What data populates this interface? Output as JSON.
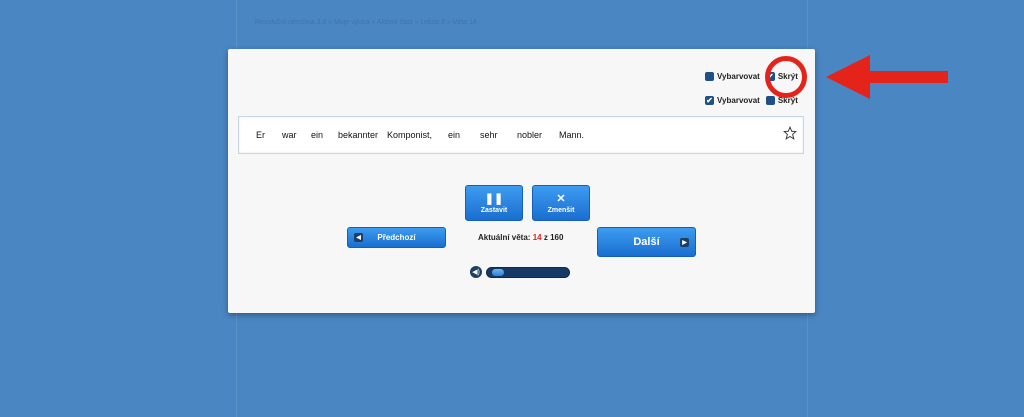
{
  "breadcrumb": "Revoluční němčina 3.0 » Moje výuka » Aktivní část » Lekce 8 » Věta 14",
  "options": {
    "row1": {
      "colorize_label": "Vybarvovat",
      "colorize_checked": false,
      "hide_label": "Skrýt",
      "hide_checked": true
    },
    "row2": {
      "colorize_label": "Vybarvovat",
      "colorize_checked": true,
      "hide_label": "Skrýt",
      "hide_checked": false
    }
  },
  "sentence": {
    "words": [
      "Er",
      "war",
      "ein",
      "bekannter",
      "Komponist,",
      "ein",
      "sehr",
      "nobler",
      "Mann."
    ]
  },
  "controls": {
    "pause_label": "Zastavit",
    "shrink_label": "Zmenšit",
    "prev_label": "Předchozí",
    "next_label": "Další"
  },
  "counter": {
    "label": "Aktuální věta:",
    "current": "14",
    "separator": "z",
    "total": "160"
  },
  "audio": {
    "progress": 0.05
  },
  "colors": {
    "background": "#4a86c2",
    "accent": "#1a6ecf",
    "annotation": "#e4231b"
  }
}
